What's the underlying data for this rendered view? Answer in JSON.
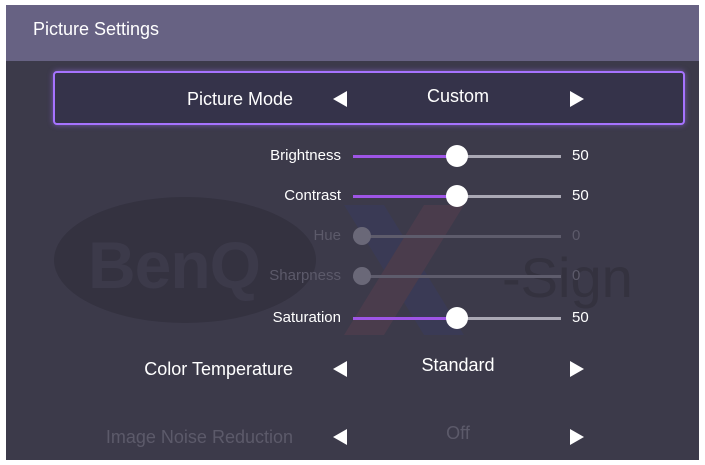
{
  "header": {
    "title": "Picture Settings"
  },
  "watermark": {
    "brand": "BenQ",
    "product": "-Sign"
  },
  "picture_mode": {
    "label": "Picture Mode",
    "value": "Custom"
  },
  "sliders": [
    {
      "label": "Brightness",
      "value": 50,
      "level": 0.5,
      "enabled": true
    },
    {
      "label": "Contrast",
      "value": 50,
      "level": 0.5,
      "enabled": true
    },
    {
      "label": "Hue",
      "value": 0,
      "level": 0.0,
      "enabled": false
    },
    {
      "label": "Sharpness",
      "value": 0,
      "level": 0.0,
      "enabled": false
    },
    {
      "label": "Saturation",
      "value": 50,
      "level": 0.5,
      "enabled": true
    }
  ],
  "color_temperature": {
    "label": "Color Temperature",
    "value": "Standard"
  },
  "noise_reduction": {
    "label": "Image Noise Reduction",
    "value": "Off",
    "enabled": false
  },
  "colors": {
    "accent": "#a673ff",
    "slider_fill": "#9e55e6",
    "header_bg": "#676283",
    "panel_bg": "#3c3a4a"
  }
}
